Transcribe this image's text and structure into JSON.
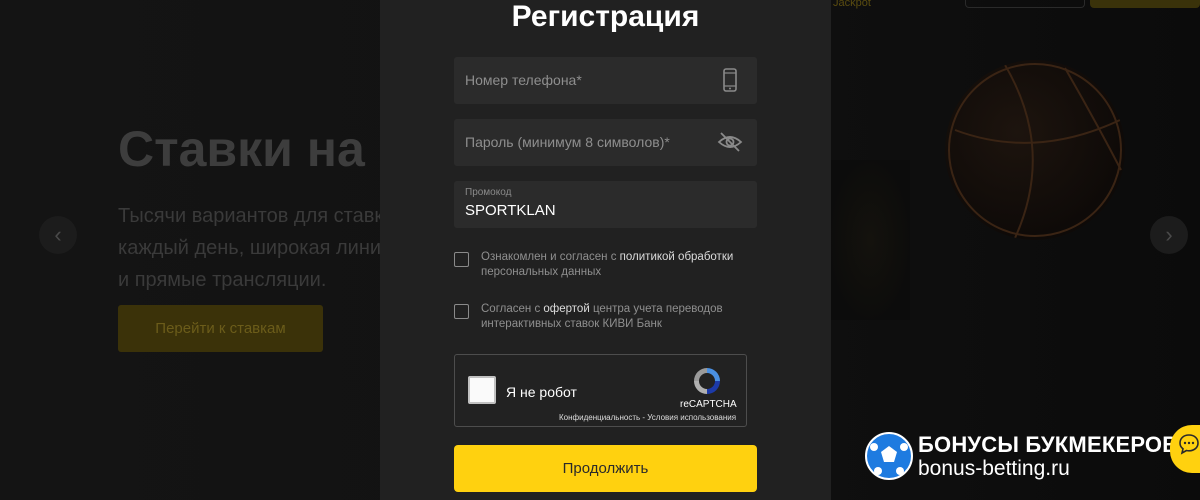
{
  "background": {
    "jackpot": "Jackpot",
    "headline": "Ставки на с",
    "subtext_lines": [
      "Тысячи вариантов для ставки",
      "каждый день, широкая линия",
      "и прямые трансляции."
    ],
    "cta_label": "Перейти к ставкам"
  },
  "modal": {
    "title": "Регистрация",
    "phone": {
      "placeholder": "Номер телефона*",
      "icon": "phone-icon"
    },
    "password": {
      "placeholder": "Пароль (минимум 8 символов)*",
      "icon": "eye-slash-icon"
    },
    "promo": {
      "label": "Промокод",
      "value": "SPORTKLAN"
    },
    "consent1": {
      "prefix": "Ознакомлен и согласен с ",
      "link": "политикой обработки",
      "line2": "персональных данных"
    },
    "consent2": {
      "prefix": "Согласен с ",
      "link": "офертой",
      "suffix": " центра учета переводов",
      "line2": "интерактивных ставок КИВИ Банк"
    },
    "captcha": {
      "label": "Я не робот",
      "brand": "reCAPTCHA",
      "links": "Конфиденциальность - Условия использования"
    },
    "submit_label": "Продолжить"
  },
  "watermark": {
    "line1": "БОНУСЫ БУКМЕКЕРОВ",
    "line2": "bonus-betting.ru"
  },
  "colors": {
    "accent": "#ffd10f",
    "modal_bg": "#212121",
    "field_bg": "#2b2b2b"
  }
}
